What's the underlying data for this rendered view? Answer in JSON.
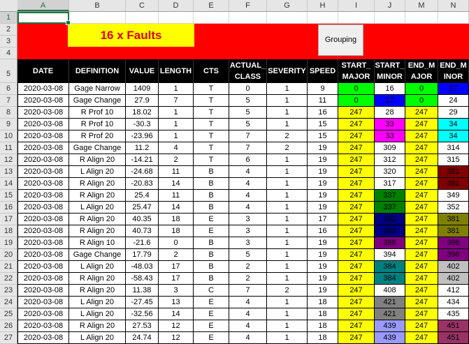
{
  "columns": [
    "A",
    "B",
    "C",
    "D",
    "E",
    "F",
    "G",
    "H",
    "I",
    "J",
    "M",
    "N"
  ],
  "selected_column": "A",
  "row_numbers": [
    "1",
    "2",
    "3",
    "4",
    "5",
    "6",
    "7",
    "8",
    "9",
    "10",
    "11",
    "12",
    "13",
    "14",
    "15",
    "16",
    "17",
    "18",
    "19",
    "20",
    "21",
    "22",
    "23",
    "24",
    "25",
    "26",
    "27"
  ],
  "title": "16 x Faults",
  "grouping_button": "Grouping",
  "headers": [
    "DATE",
    "DEFINITION",
    "VALUE",
    "LENGTH",
    "CTS",
    "ACTUAL_\nCLASS",
    "SEVERITY",
    "SPEED",
    "START_\nMAJOR",
    "START_\nMINOR",
    "END_M\nAJOR",
    "END_M\nINOR"
  ],
  "colors": {
    "banner_red": "#ff0000",
    "title_yellow": "#ffff00",
    "title_text_red": "#e00000",
    "header_black": "#000000"
  },
  "rows": [
    {
      "cells": [
        "2020-03-08",
        "Gage Narrow",
        "1409",
        "1",
        "T",
        "0",
        "1",
        "9",
        "0",
        "16",
        "0",
        "17"
      ],
      "colors": [
        "#00ff00",
        "#ffffff",
        "#00ff00",
        "#0000ff"
      ]
    },
    {
      "cells": [
        "2020-03-08",
        "Gage Change",
        "27.9",
        "7",
        "T",
        "5",
        "1",
        "11",
        "0",
        "17",
        "0",
        "24"
      ],
      "colors": [
        "#00ff00",
        "#0000ff",
        "#00ff00",
        "#ffffff"
      ]
    },
    {
      "cells": [
        "2020-03-08",
        "R Prof 10",
        "18.02",
        "1",
        "T",
        "5",
        "1",
        "16",
        "247",
        "28",
        "247",
        "29"
      ],
      "colors": [
        "#ffff00",
        "#ffffff",
        "#ffff00",
        "#ffffff"
      ]
    },
    {
      "cells": [
        "2020-03-08",
        "R Prof 10",
        "-30.3",
        "1",
        "T",
        "5",
        "1",
        "15",
        "247",
        "33",
        "247",
        "34"
      ],
      "colors": [
        "#ffff00",
        "#ff00ff",
        "#ffff00",
        "#00ffff"
      ]
    },
    {
      "cells": [
        "2020-03-08",
        "R Prof 20",
        "-23.96",
        "1",
        "T",
        "7",
        "2",
        "15",
        "247",
        "33",
        "247",
        "34"
      ],
      "colors": [
        "#ffff00",
        "#ff00ff",
        "#ffff00",
        "#00ffff"
      ]
    },
    {
      "cells": [
        "2020-03-08",
        "Gage Change",
        "11.2",
        "4",
        "T",
        "7",
        "2",
        "19",
        "247",
        "309",
        "247",
        "314"
      ],
      "colors": [
        "#ffff00",
        "#ffffff",
        "#ffff00",
        "#ffffff"
      ]
    },
    {
      "cells": [
        "2020-03-08",
        "R Align 20",
        "-14.21",
        "2",
        "T",
        "6",
        "1",
        "19",
        "247",
        "312",
        "247",
        "315"
      ],
      "colors": [
        "#ffff00",
        "#ffffff",
        "#ffff00",
        "#ffffff"
      ]
    },
    {
      "cells": [
        "2020-03-08",
        "L Align 20",
        "-24.68",
        "11",
        "B",
        "4",
        "1",
        "19",
        "247",
        "320",
        "247",
        "381"
      ],
      "colors": [
        "#ffff00",
        "#ffffff",
        "#ffff00",
        "#800000"
      ]
    },
    {
      "cells": [
        "2020-03-08",
        "R Align 20",
        "-20.83",
        "14",
        "B",
        "4",
        "1",
        "19",
        "247",
        "317",
        "247",
        "381"
      ],
      "colors": [
        "#ffff00",
        "#ffffff",
        "#ffff00",
        "#800000"
      ]
    },
    {
      "cells": [
        "2020-03-08",
        "R Align 20",
        "25.4",
        "11",
        "B",
        "4",
        "1",
        "19",
        "247",
        "337",
        "247",
        "349"
      ],
      "colors": [
        "#ffff00",
        "#008000",
        "#ffff00",
        "#ffffff"
      ]
    },
    {
      "cells": [
        "2020-03-08",
        "L Align 20",
        "25.47",
        "14",
        "B",
        "4",
        "1",
        "19",
        "247",
        "337",
        "247",
        "352"
      ],
      "colors": [
        "#ffff00",
        "#008000",
        "#ffff00",
        "#ffffff"
      ]
    },
    {
      "cells": [
        "2020-03-08",
        "R Align 20",
        "40.35",
        "18",
        "E",
        "3",
        "1",
        "17",
        "247",
        "362",
        "247",
        "381"
      ],
      "colors": [
        "#ffff00",
        "#000080",
        "#ffff00",
        "#808000"
      ]
    },
    {
      "cells": [
        "2020-03-08",
        "R Align 20",
        "40.73",
        "18",
        "E",
        "3",
        "1",
        "16",
        "247",
        "362",
        "247",
        "381"
      ],
      "colors": [
        "#ffff00",
        "#000080",
        "#ffff00",
        "#808000"
      ]
    },
    {
      "cells": [
        "2020-03-08",
        "R Align 10",
        "-21.6",
        "0",
        "B",
        "3",
        "1",
        "19",
        "247",
        "386",
        "247",
        "396"
      ],
      "colors": [
        "#ffff00",
        "#800080",
        "#ffff00",
        "#800080"
      ]
    },
    {
      "cells": [
        "2020-03-08",
        "Gage Change",
        "17.79",
        "2",
        "B",
        "5",
        "1",
        "19",
        "247",
        "394",
        "247",
        "396"
      ],
      "colors": [
        "#ffff00",
        "#ffffff",
        "#ffff00",
        "#800080"
      ]
    },
    {
      "cells": [
        "2020-03-08",
        "L Align 20",
        "-48.03",
        "17",
        "B",
        "2",
        "1",
        "19",
        "247",
        "384",
        "247",
        "402"
      ],
      "colors": [
        "#ffff00",
        "#008080",
        "#ffff00",
        "#c0c0c0"
      ]
    },
    {
      "cells": [
        "2020-03-08",
        "R Align 20",
        "-58.43",
        "17",
        "B",
        "2",
        "1",
        "19",
        "247",
        "384",
        "247",
        "402"
      ],
      "colors": [
        "#ffff00",
        "#008080",
        "#ffff00",
        "#c0c0c0"
      ]
    },
    {
      "cells": [
        "2020-03-08",
        "R Align 20",
        "11.38",
        "3",
        "C",
        "7",
        "2",
        "19",
        "247",
        "408",
        "247",
        "412"
      ],
      "colors": [
        "#ffff00",
        "#ffffff",
        "#ffff00",
        "#ffffff"
      ]
    },
    {
      "cells": [
        "2020-03-08",
        "L Align 20",
        "-27.45",
        "13",
        "E",
        "4",
        "1",
        "18",
        "247",
        "421",
        "247",
        "434"
      ],
      "colors": [
        "#ffff00",
        "#808080",
        "#ffff00",
        "#ffffff"
      ]
    },
    {
      "cells": [
        "2020-03-08",
        "L Align 20",
        "-32.56",
        "14",
        "E",
        "4",
        "1",
        "18",
        "247",
        "421",
        "247",
        "435"
      ],
      "colors": [
        "#ffff00",
        "#808080",
        "#ffff00",
        "#ffffff"
      ]
    },
    {
      "cells": [
        "2020-03-08",
        "R Align 20",
        "27.53",
        "12",
        "E",
        "4",
        "1",
        "18",
        "247",
        "439",
        "247",
        "451"
      ],
      "colors": [
        "#ffff00",
        "#9999ff",
        "#ffff00",
        "#993366"
      ]
    },
    {
      "cells": [
        "2020-03-08",
        "L Align 20",
        "24.74",
        "12",
        "E",
        "4",
        "1",
        "18",
        "247",
        "439",
        "247",
        "451"
      ],
      "colors": [
        "#ffff00",
        "#9999ff",
        "#ffff00",
        "#993366"
      ]
    }
  ]
}
